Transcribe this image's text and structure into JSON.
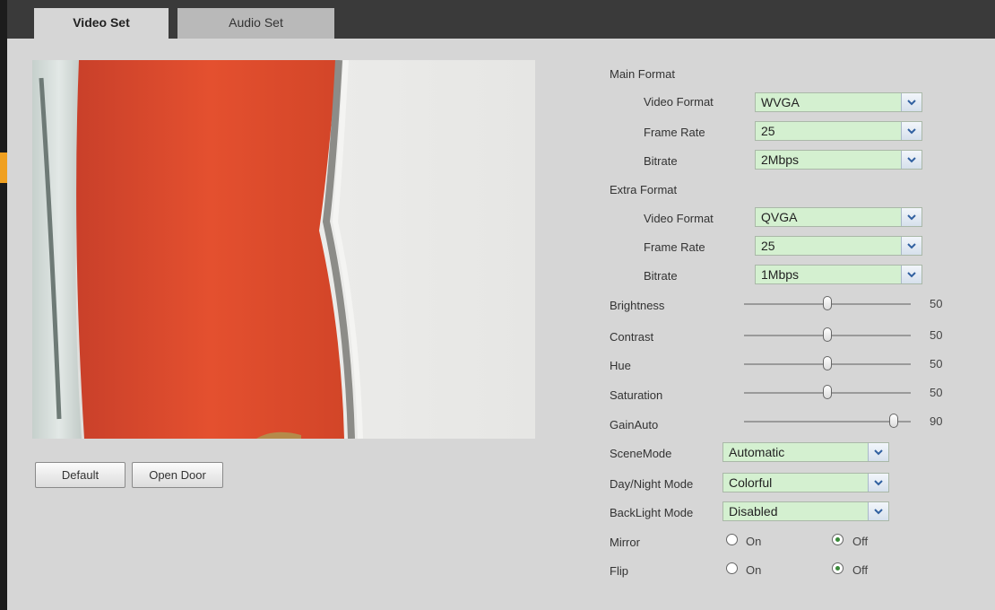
{
  "tabs": [
    {
      "label": "Video Set",
      "active": true
    },
    {
      "label": "Audio Set",
      "active": false
    }
  ],
  "buttons": {
    "default": "Default",
    "open_door": "Open Door"
  },
  "main_format": {
    "title": "Main Format",
    "video_format_label": "Video Format",
    "video_format": "WVGA",
    "frame_rate_label": "Frame Rate",
    "frame_rate": "25",
    "bitrate_label": "Bitrate",
    "bitrate": "2Mbps"
  },
  "extra_format": {
    "title": "Extra Format",
    "video_format_label": "Video Format",
    "video_format": "QVGA",
    "frame_rate_label": "Frame Rate",
    "frame_rate": "25",
    "bitrate_label": "Bitrate",
    "bitrate": "1Mbps"
  },
  "sliders": [
    {
      "label": "Brightness",
      "value": "50"
    },
    {
      "label": "Contrast",
      "value": "50"
    },
    {
      "label": "Hue",
      "value": "50"
    },
    {
      "label": "Saturation",
      "value": "50"
    },
    {
      "label": "GainAuto",
      "value": "90"
    }
  ],
  "scene_mode": {
    "label": "SceneMode",
    "value": "Automatic"
  },
  "day_night_mode": {
    "label": "Day/Night Mode",
    "value": "Colorful"
  },
  "backlight_mode": {
    "label": "BackLight Mode",
    "value": "Disabled"
  },
  "mirror": {
    "label": "Mirror",
    "on": "On",
    "off": "Off",
    "selected": "Off"
  },
  "flip": {
    "label": "Flip",
    "on": "On",
    "off": "Off",
    "selected": "Off"
  },
  "colors": {
    "select_bg": "#d4f0d0",
    "tab_bar": "#3a3a3a",
    "page_bg": "#d6d6d6",
    "accent": "#f0a020"
  }
}
